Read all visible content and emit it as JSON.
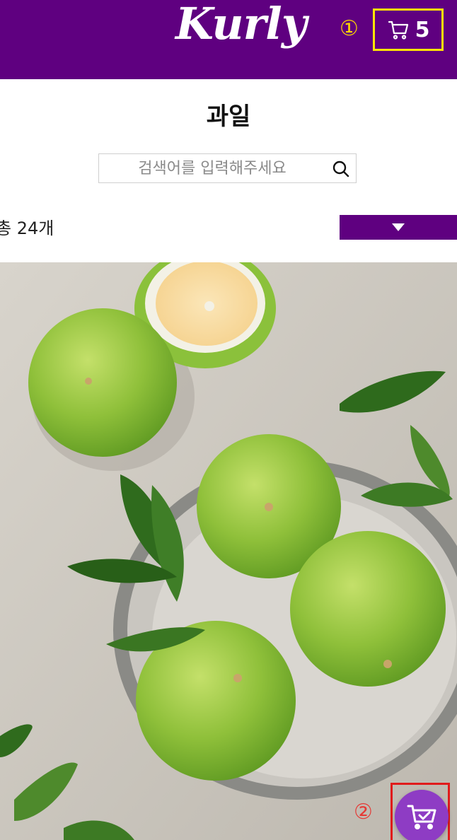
{
  "header": {
    "logo_text": "Kurly",
    "marker_1": "①",
    "cart_count": "5"
  },
  "page_title": "과일",
  "search": {
    "placeholder": "검색어를 입력해주세요"
  },
  "product_count": "총 24개",
  "floating": {
    "marker_2": "②"
  },
  "colors": {
    "brand": "#5f0080",
    "highlight_yellow": "#ffe600",
    "highlight_red": "#e01b1b",
    "float_cart": "#8e3cc4"
  },
  "icons": [
    "cart-icon",
    "search-icon",
    "chevron-down-icon",
    "cart-check-icon"
  ]
}
